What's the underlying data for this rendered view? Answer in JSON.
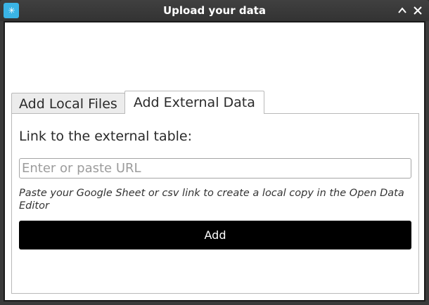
{
  "window": {
    "title": "Upload your data",
    "icon": "app-logo-icon",
    "controls": [
      "chevron-up-icon",
      "close-icon"
    ]
  },
  "tabs": [
    {
      "label": "Add Local Files",
      "active": false
    },
    {
      "label": "Add External Data",
      "active": true
    }
  ],
  "external_data": {
    "link_label": "Link to the external table:",
    "url_placeholder": "Enter or paste URL",
    "url_value": "",
    "help_text": "Paste your Google Sheet or csv link to create a local copy in the Open Data Editor",
    "add_label": "Add"
  },
  "colors": {
    "app_icon_bg": "#3ab4e6",
    "add_button_bg": "#000000",
    "add_button_text": "#ffffff",
    "title_bar": "#3a3a3a"
  }
}
